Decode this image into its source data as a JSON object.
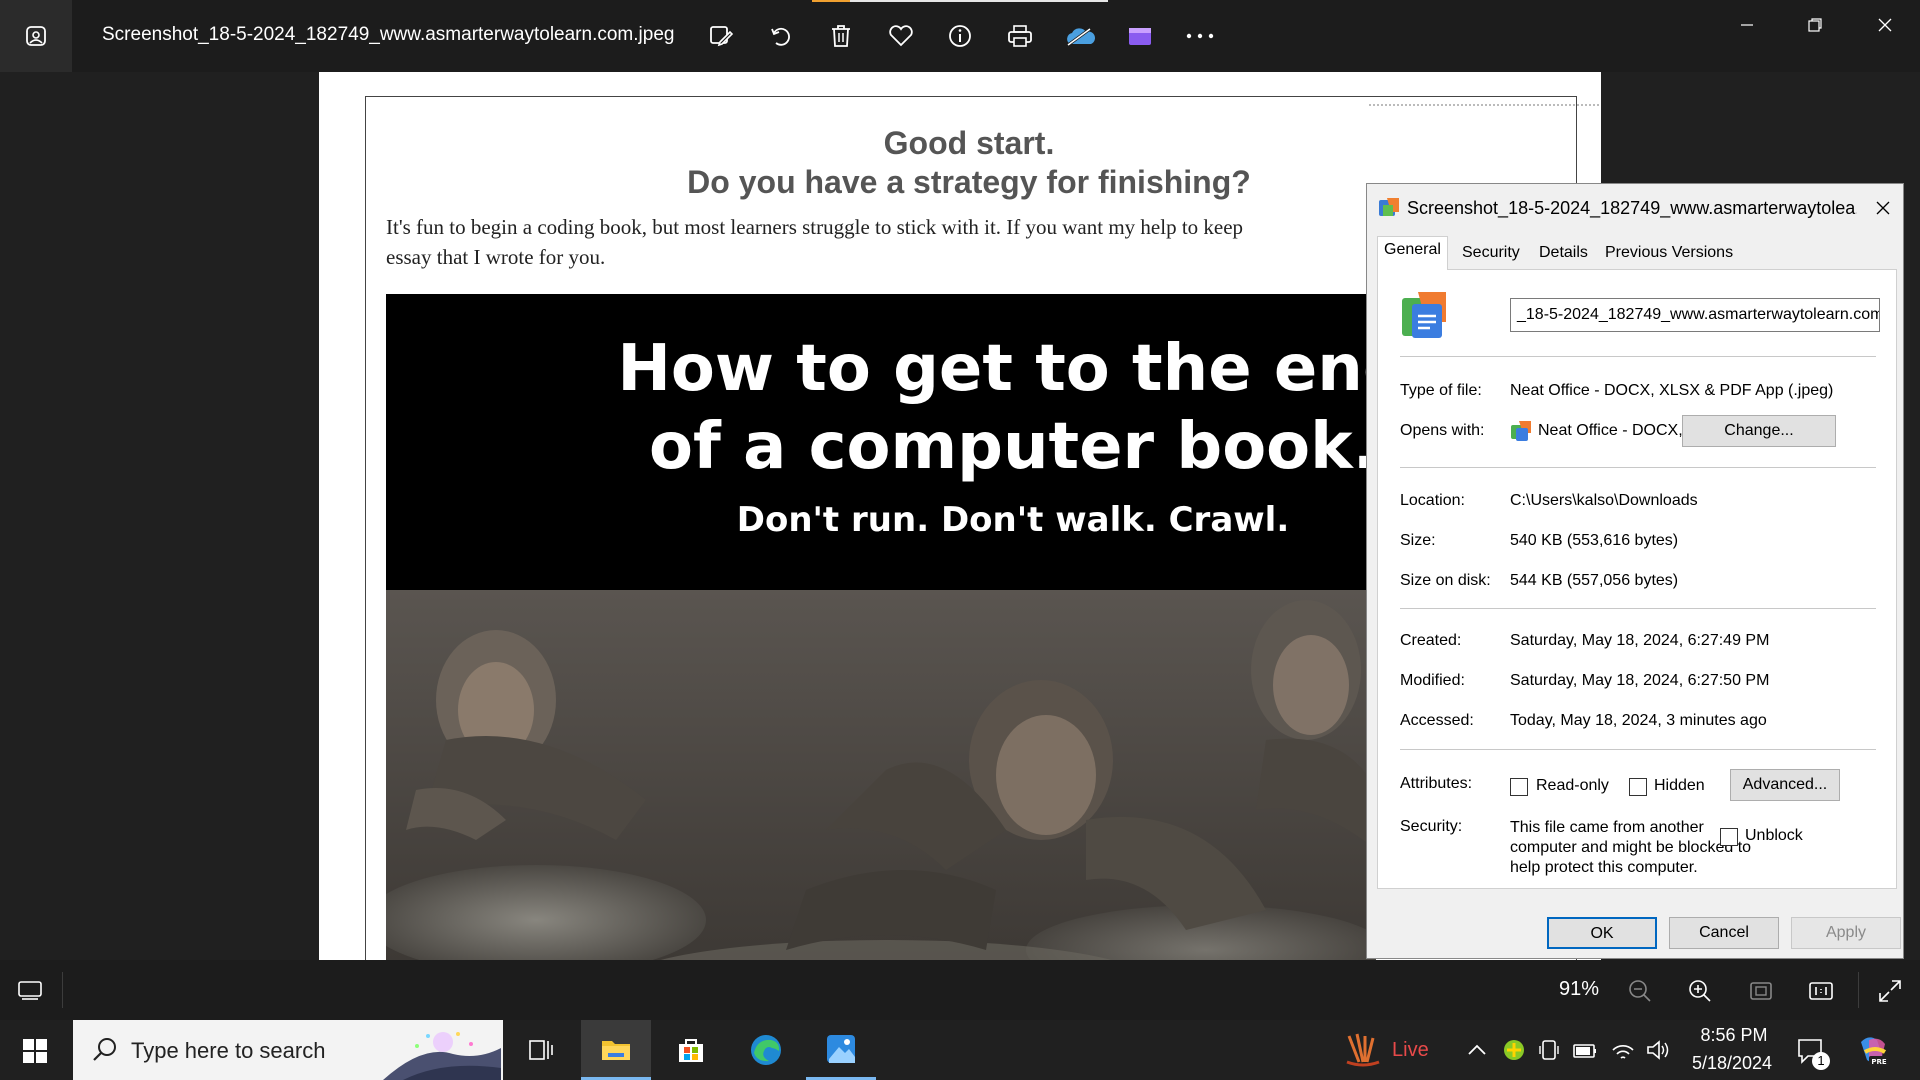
{
  "app": {
    "file_title": "Screenshot_18-5-2024_182749_www.asmarterwaytolearn.com.jpeg",
    "toolbar_icons": [
      "edit-image-icon",
      "rotate-icon",
      "delete-icon",
      "favorite-icon",
      "info-icon",
      "print-icon",
      "onedrive-icon",
      "clipchamp-icon",
      "more-icon"
    ]
  },
  "image": {
    "heading_line1": "Good start.",
    "heading_line2": "Do you have a strategy for finishing?",
    "body_line1": "It's fun to begin a coding book, but most learners struggle to stick with it. If you want my help to keep",
    "body_line2": "essay that I wrote for you.",
    "banner_line1": "How to get to the end",
    "banner_line2": "of a computer book.",
    "banner_line3": "Don't run. Don't walk. Crawl."
  },
  "dialog": {
    "title": "Screenshot_18-5-2024_182749_www.asmarterwaytolea...",
    "tabs": [
      "General",
      "Security",
      "Details",
      "Previous Versions"
    ],
    "file_name": "_18-5-2024_182749_www.asmarterwaytolearn.com",
    "type_label": "Type of file:",
    "type_value": "Neat Office - DOCX, XLSX & PDF App (.jpeg)",
    "opens_label": "Opens with:",
    "opens_value": "Neat Office - DOCX, XL",
    "change_button": "Change...",
    "location_label": "Location:",
    "location_value": "C:\\Users\\kalso\\Downloads",
    "size_label": "Size:",
    "size_value": "540 KB (553,616 bytes)",
    "size_disk_label": "Size on disk:",
    "size_disk_value": "544 KB (557,056 bytes)",
    "created_label": "Created:",
    "created_value": "Saturday, May 18, 2024, 6:27:49 PM",
    "modified_label": "Modified:",
    "modified_value": "Saturday, May 18, 2024, 6:27:50 PM",
    "accessed_label": "Accessed:",
    "accessed_value": "Today, May 18, 2024, 3 minutes ago",
    "attributes_label": "Attributes:",
    "readonly_label": "Read-only",
    "hidden_label": "Hidden",
    "advanced_button": "Advanced...",
    "security_label": "Security:",
    "security_line1": "This file came from another",
    "security_line2": "computer and might be blocked to",
    "security_line3": "help protect this computer.",
    "unblock_label": "Unblock",
    "ok_button": "OK",
    "cancel_button": "Cancel",
    "apply_button": "Apply"
  },
  "zoom": {
    "percent": "91%"
  },
  "taskbar": {
    "search_placeholder": "Type here to search",
    "live_label": "Live",
    "time": "8:56 PM",
    "date": "5/18/2024",
    "notification_count": "1"
  }
}
